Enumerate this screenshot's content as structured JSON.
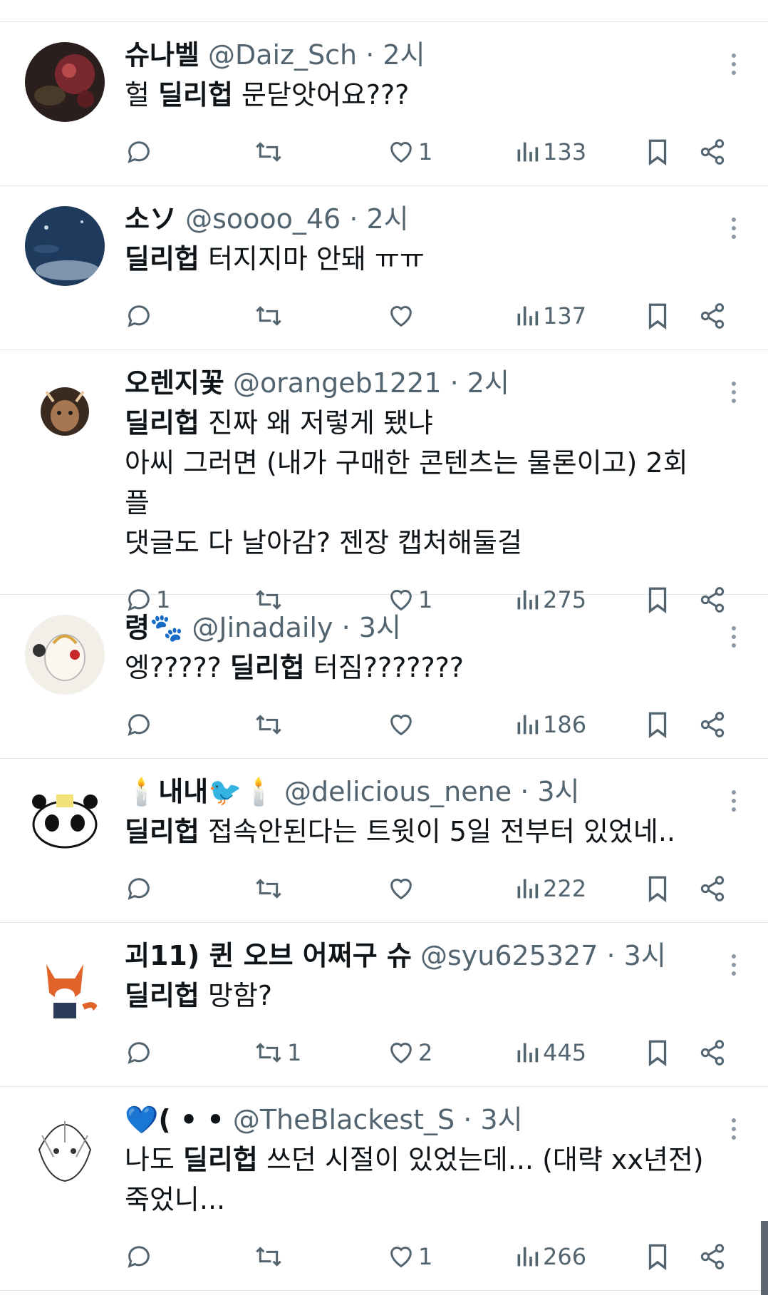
{
  "tweets": [
    {
      "name": "슈나벨",
      "handle": "@Daiz_Sch",
      "time": "2시",
      "body_parts": [
        {
          "text": "헐 ",
          "bold": false
        },
        {
          "text": "딜리헙",
          "bold": true
        },
        {
          "text": " 문닫앗어요???",
          "bold": false
        }
      ],
      "reply_count": "",
      "retweet_count": "",
      "like_count": "1",
      "view_count": "133",
      "avatar_colors": [
        "#2a1f1d",
        "#7a2830",
        "#b84a4a"
      ]
    },
    {
      "name": "소ソ",
      "handle": "@soooo_46",
      "time": "2시",
      "body_parts": [
        {
          "text": "딜리헙",
          "bold": true
        },
        {
          "text": " 터지지마 안돼 ㅠㅠ",
          "bold": false
        }
      ],
      "reply_count": "",
      "retweet_count": "",
      "like_count": "",
      "view_count": "137",
      "avatar_colors": [
        "#1e3a5c",
        "#2f4f74",
        "#c9d6e3"
      ]
    },
    {
      "name": "오렌지꽃",
      "handle": "@orangeb1221",
      "time": "2시",
      "body_parts": [
        {
          "text": "딜리헙",
          "bold": true
        },
        {
          "text": " 진짜 왜 저렇게 됐냐",
          "bold": false
        }
      ],
      "extra_lines": [
        "아씨 그러면 (내가 구매한 콘텐츠는 물론이고) 2회플",
        "댓글도 다 날아감? 젠장 캡처해둘걸"
      ],
      "reply_count": "1",
      "retweet_count": "",
      "like_count": "1",
      "view_count": "275",
      "avatar_colors": [
        "#3b2a1f",
        "#a67750",
        "#e7c9a0"
      ]
    },
    {
      "name": "령🐾",
      "handle": "@Jinadaily",
      "time": "3시",
      "body_parts": [
        {
          "text": "엥????? ",
          "bold": false
        },
        {
          "text": "딜리헙",
          "bold": true
        },
        {
          "text": " 터짐???????",
          "bold": false
        }
      ],
      "reply_count": "",
      "retweet_count": "",
      "like_count": "",
      "view_count": "186",
      "avatar_colors": [
        "#f2efe9",
        "#d9a441",
        "#c82a2a"
      ]
    },
    {
      "name": "🕯️내내🐦🕯️",
      "handle": "@delicious_nene",
      "time": "3시",
      "body_parts": [
        {
          "text": "딜리헙",
          "bold": true
        },
        {
          "text": " 접속안된다는 트윗이 5일 전부터 있었네..",
          "bold": false
        }
      ],
      "reply_count": "",
      "retweet_count": "",
      "like_count": "",
      "view_count": "222",
      "avatar_colors": [
        "#ffffff",
        "#111111",
        "#f3e27a"
      ]
    },
    {
      "name": "괴11) 퀸 오브 어쩌구 슈",
      "handle": "@syu625327",
      "time": "3시",
      "body_parts": [
        {
          "text": "딜리헙",
          "bold": true
        },
        {
          "text": " 망함?",
          "bold": false
        }
      ],
      "reply_count": "",
      "retweet_count": "1",
      "like_count": "2",
      "view_count": "445",
      "avatar_colors": [
        "#ffffff",
        "#e0642a",
        "#2d3b5a"
      ]
    },
    {
      "name": "💙( • •",
      "handle": "@TheBlackest_S",
      "time": "3시",
      "body_parts": [
        {
          "text": "나도 ",
          "bold": false
        },
        {
          "text": "딜리헙",
          "bold": true
        },
        {
          "text": " 쓰던 시절이 있었는데... (대략 xx년전)",
          "bold": false
        }
      ],
      "extra_lines": [
        "죽었니..."
      ],
      "reply_count": "",
      "retweet_count": "",
      "like_count": "1",
      "view_count": "266",
      "avatar_colors": [
        "#ffffff",
        "#333333",
        "#999999"
      ]
    }
  ],
  "icons": {
    "reply": "reply-icon",
    "retweet": "retweet-icon",
    "like": "heart-icon",
    "views": "views-icon",
    "bookmark": "bookmark-icon",
    "share": "share-icon",
    "more": "more-icon"
  },
  "colors": {
    "text": "#0f1419",
    "secondary": "#536471",
    "divider": "#e6e9ec"
  }
}
